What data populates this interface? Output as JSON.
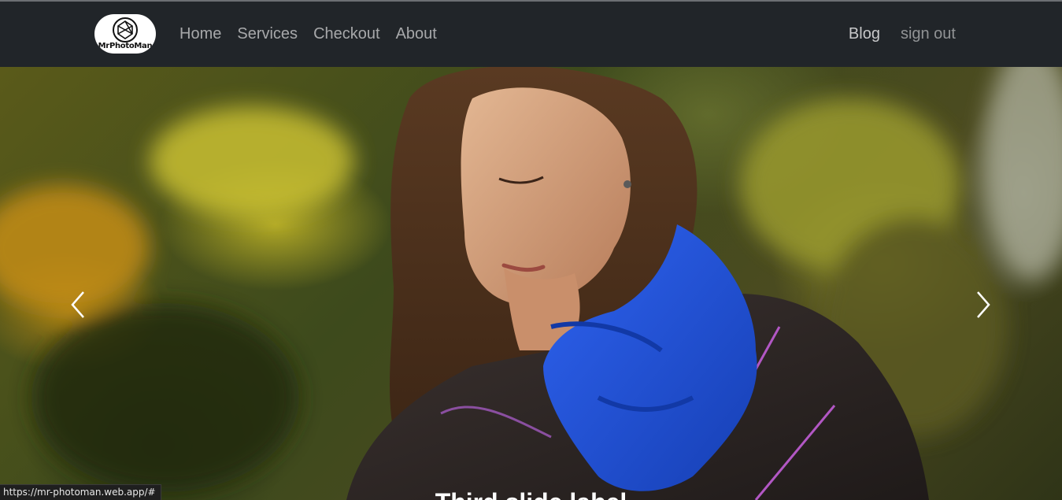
{
  "brand": {
    "logo_text": "MrPhotoMan"
  },
  "nav": {
    "left": [
      {
        "label": "Home"
      },
      {
        "label": "Services"
      },
      {
        "label": "Checkout"
      },
      {
        "label": "About"
      }
    ],
    "right": {
      "blog": "Blog",
      "sign_out": "sign out"
    }
  },
  "carousel": {
    "caption": "Third slide label",
    "prev_icon": "chevron-left-icon",
    "next_icon": "chevron-right-icon"
  },
  "status_bar": {
    "url": "https://mr-photoman.web.app/#"
  },
  "colors": {
    "navbar_bg": "#212529",
    "nav_link": "#9a9da0",
    "scarf_blue": "#1f4fd6"
  }
}
